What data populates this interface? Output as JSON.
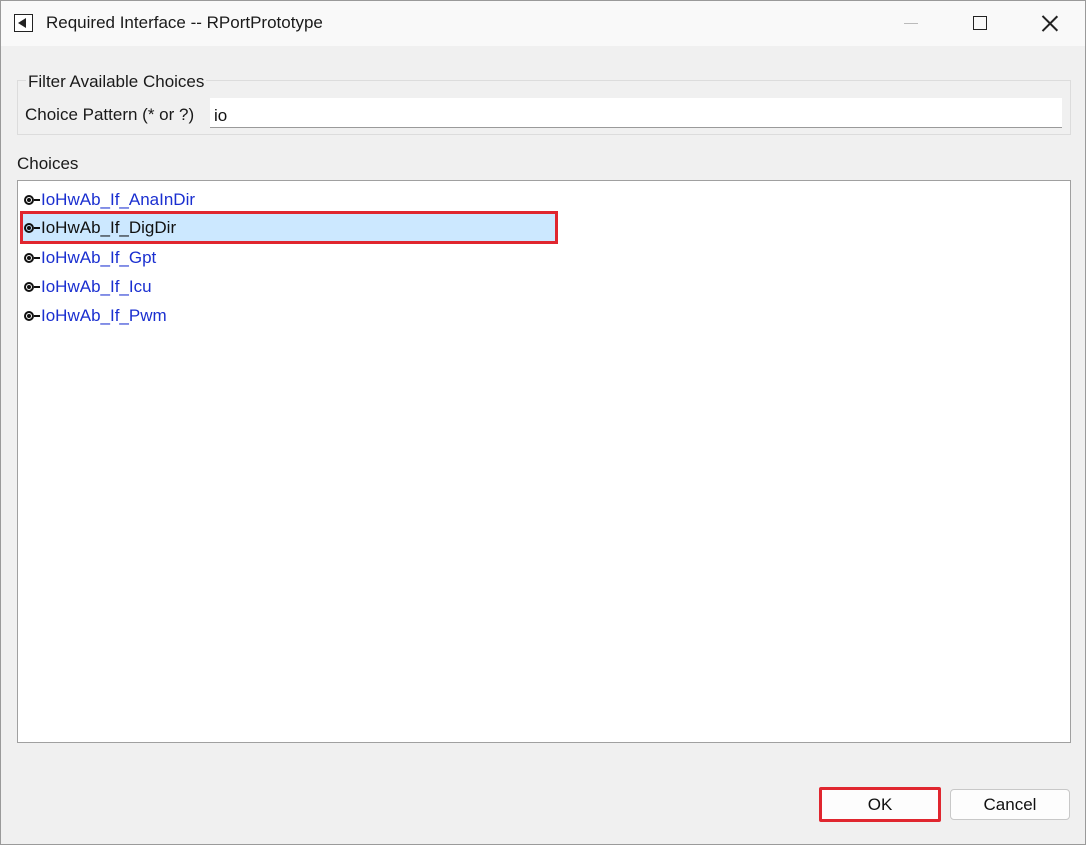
{
  "window": {
    "title": "Required Interface -- RPortPrototype",
    "icons": {
      "app": "back-arrow-icon",
      "minimize": "minimize-icon",
      "maximize": "maximize-icon",
      "close": "close-icon"
    }
  },
  "filter": {
    "group_label": "Filter Available Choices",
    "pattern_label": "Choice Pattern (* or ?)",
    "pattern_value": "io"
  },
  "choices": {
    "label": "Choices",
    "items": [
      {
        "label": "IoHwAb_If_AnaInDir",
        "selected": false,
        "icon": "port-icon"
      },
      {
        "label": "IoHwAb_If_DigDir",
        "selected": true,
        "icon": "port-icon"
      },
      {
        "label": "IoHwAb_If_Gpt",
        "selected": false,
        "icon": "port-icon"
      },
      {
        "label": "IoHwAb_If_Icu",
        "selected": false,
        "icon": "port-icon"
      },
      {
        "label": "IoHwAb_If_Pwm",
        "selected": false,
        "icon": "port-icon"
      }
    ]
  },
  "buttons": {
    "ok": "OK",
    "cancel": "Cancel"
  },
  "colors": {
    "link": "#1a2fd0",
    "selection": "#cce8ff",
    "highlight": "#e0262f"
  }
}
